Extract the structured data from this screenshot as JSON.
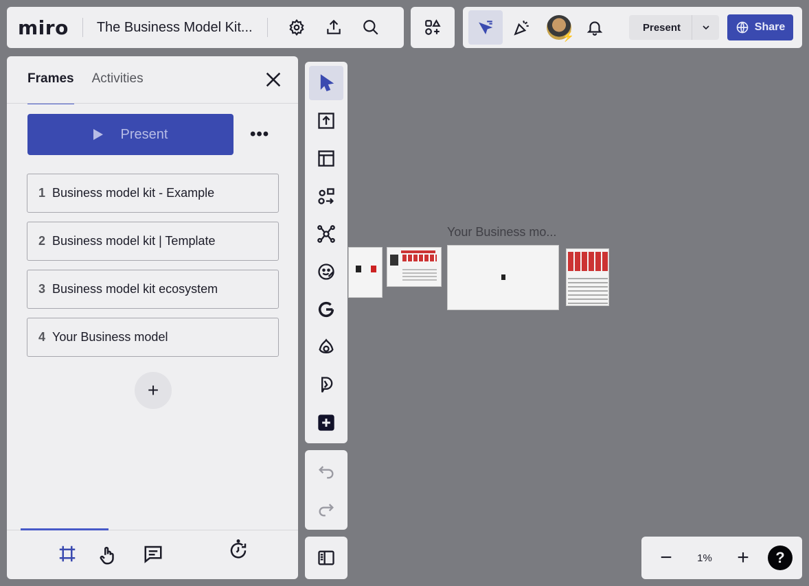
{
  "header": {
    "logo": "miro",
    "board_title": "The Business Model Kit...",
    "present_label": "Present",
    "share_label": "Share"
  },
  "frames_panel": {
    "tabs": [
      {
        "label": "Frames",
        "active": true
      },
      {
        "label": "Activities",
        "active": false
      }
    ],
    "present_label": "Present",
    "more_label": "•••",
    "frames": [
      {
        "num": "1",
        "label": "Business model kit - Example"
      },
      {
        "num": "2",
        "label": "Business model kit | Template"
      },
      {
        "num": "3",
        "label": "Business model kit ecosystem"
      },
      {
        "num": "4",
        "label": "Your Business model"
      }
    ],
    "add_label": "+"
  },
  "canvas": {
    "frame_label": "Your Business mo..."
  },
  "zoom": {
    "minus": "−",
    "level": "1%",
    "plus": "+",
    "help": "?"
  },
  "icons": [
    "settings-icon",
    "upload-icon",
    "search-icon",
    "apps-icon",
    "select-cursor-icon",
    "reactions-icon",
    "bell-icon",
    "globe-icon",
    "select-icon",
    "upload-frame-icon",
    "template-icon",
    "shapes-icon",
    "mind-map-icon",
    "sticker-icon",
    "google-icon",
    "app-icon",
    "app-d-icon",
    "add-icon",
    "undo-icon",
    "redo-icon",
    "sidebar-icon",
    "frames-icon",
    "comments-icon",
    "history-icon"
  ],
  "colors": {
    "accent": "#3a4ab0",
    "panel": "#efeff1",
    "backdrop": "#7a7b80"
  }
}
